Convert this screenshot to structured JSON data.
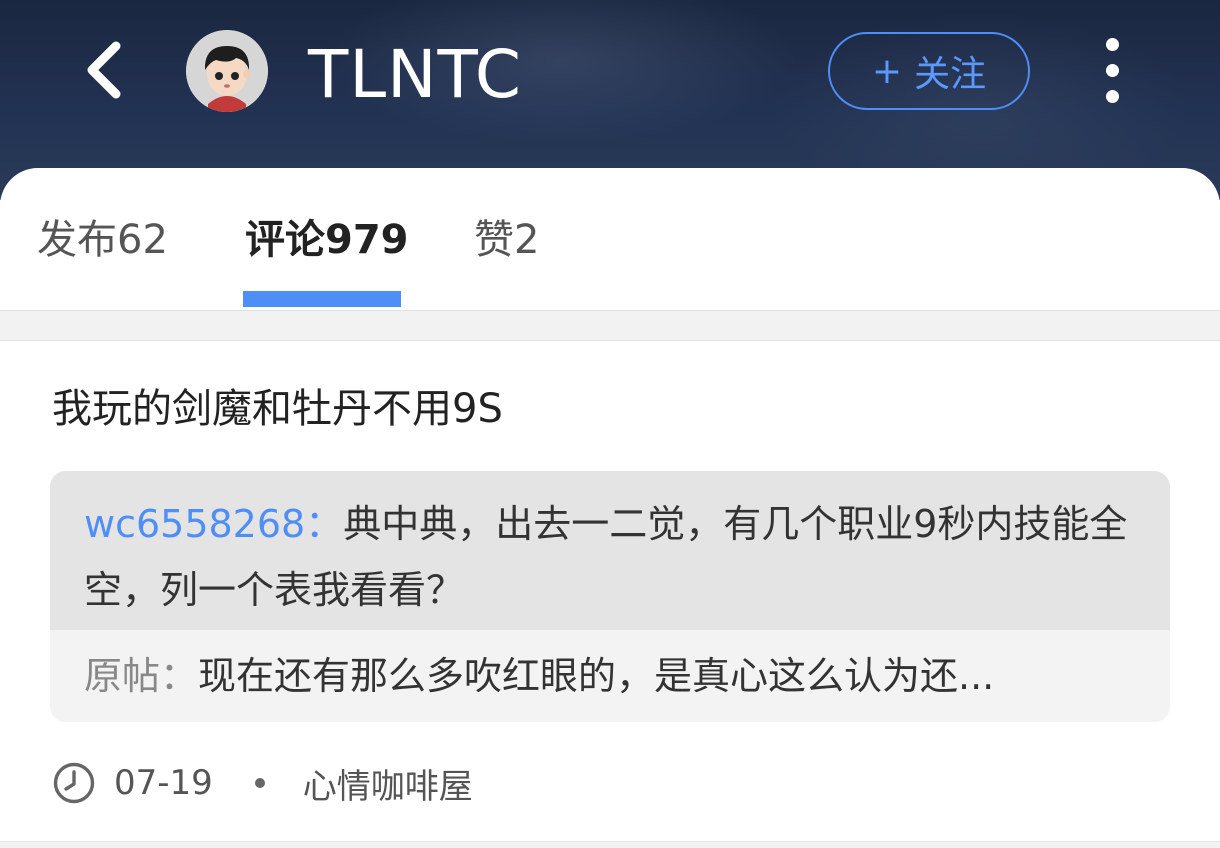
{
  "header": {
    "title": "TLNTC",
    "follow_label": "关注",
    "follow_plus": "+",
    "accent_color": "#4f8ef7"
  },
  "icons": {
    "back": "chevron-left-icon",
    "avatar": "cartoon-boy-avatar",
    "more": "vertical-dots-icon",
    "time": "clock-icon"
  },
  "tabs": [
    {
      "label": "发布62",
      "active": false
    },
    {
      "label": "评论979",
      "active": true
    },
    {
      "label": "赞2",
      "active": false
    }
  ],
  "post": {
    "text": "我玩的剑魔和牡丹不用9S",
    "reply": {
      "user": "wc6558268：",
      "text": "典中典，出去一二觉，有几个职业9秒内技能全空，列一个表我看看？"
    },
    "original": {
      "label": "原帖：",
      "text": "现在还有那么多吹红眼的，是真心这么认为还..."
    },
    "meta": {
      "date": "07-19",
      "forum": "心情咖啡屋"
    }
  }
}
